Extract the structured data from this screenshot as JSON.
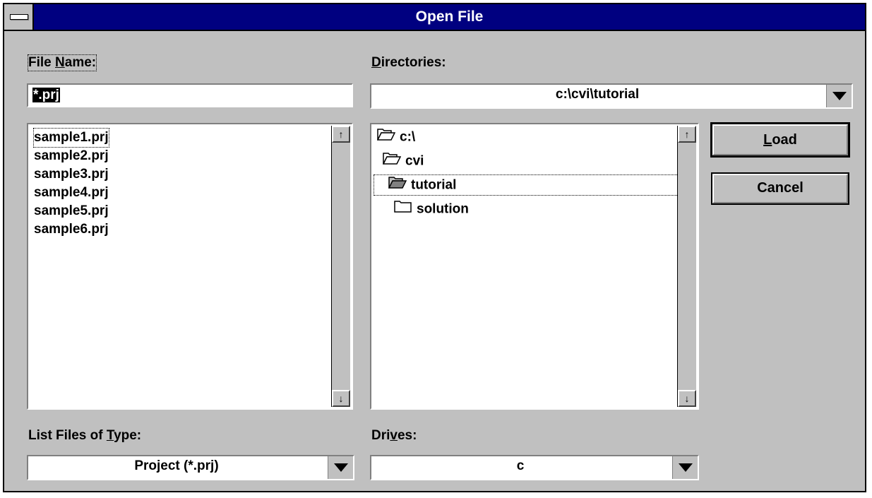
{
  "window": {
    "title": "Open File"
  },
  "file_name": {
    "label_pre": "File ",
    "label_key": "N",
    "label_post": "ame:",
    "value": "*.prj"
  },
  "files": [
    "sample1.prj",
    "sample2.prj",
    "sample3.prj",
    "sample4.prj",
    "sample5.prj",
    "sample6.prj"
  ],
  "directories": {
    "label_key": "D",
    "label_post": "irectories:",
    "current": "c:\\cvi\\tutorial",
    "items": [
      {
        "label": "c:\\",
        "icon": "open-folder-icon"
      },
      {
        "label": "cvi",
        "icon": "open-folder-icon"
      },
      {
        "label": "tutorial",
        "icon": "open-folder-filled-icon"
      },
      {
        "label": "solution",
        "icon": "closed-folder-icon"
      }
    ]
  },
  "buttons": {
    "load_key": "L",
    "load_rest": "oad",
    "cancel": "Cancel"
  },
  "file_type": {
    "label_pre": "List Files of ",
    "label_key": "T",
    "label_post": "ype:",
    "value": "Project (*.prj)"
  },
  "drives": {
    "label_pre": "Dri",
    "label_key": "v",
    "label_post": "es:",
    "value": "c"
  },
  "colors": {
    "title_bar": "#000080",
    "face": "#c0c0c0"
  }
}
